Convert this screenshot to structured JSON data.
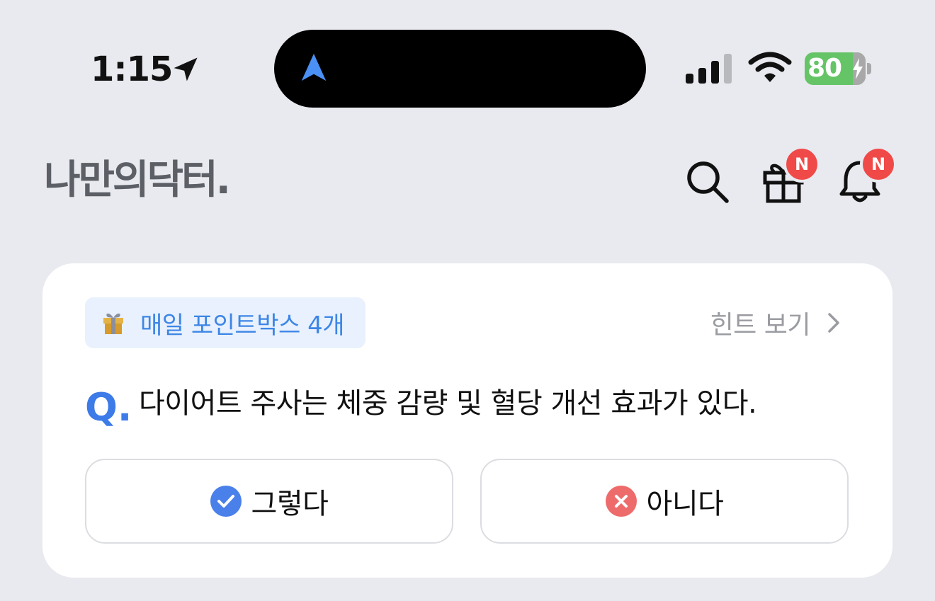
{
  "status_bar": {
    "time": "1:15",
    "battery_percent": "80",
    "icons": [
      "location-arrow-icon",
      "navigation-icon",
      "cellular-signal-icon",
      "wifi-icon",
      "battery-icon"
    ]
  },
  "header": {
    "logo_text": "나만의닥터.",
    "icons": [
      "search-icon",
      "gift-icon",
      "bell-icon"
    ],
    "gift_badge": "N",
    "bell_badge": "N",
    "badge_color": "#f04a48"
  },
  "quiz_card": {
    "points_chip": {
      "icon": "gift-icon",
      "label": "매일 포인트박스 4개"
    },
    "hint": {
      "label": "힌트 보기",
      "icon": "chevron-right-icon"
    },
    "question_prefix": "Q.",
    "question": "다이어트 주사는 체중 감량 및 혈당 개선 효과가 있다.",
    "answers": [
      {
        "label": "그렇다",
        "icon": "check-circle-icon",
        "color": "#3c7be8"
      },
      {
        "label": "아니다",
        "icon": "x-circle-icon",
        "color": "#ee6b6b"
      }
    ]
  },
  "colors": {
    "accent_blue": "#3c7be8",
    "background": "#e9eaef",
    "battery_green": "#64c466"
  }
}
